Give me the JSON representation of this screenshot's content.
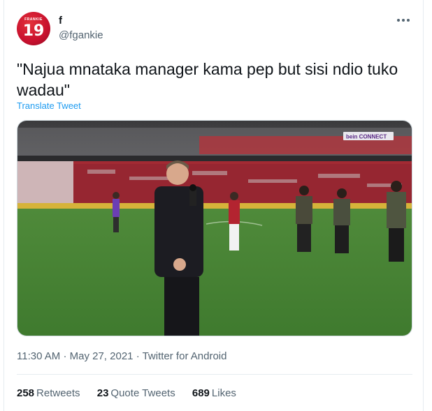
{
  "user": {
    "display_name": "f",
    "handle": "@fgankie",
    "avatar_top_text": "FRANKIE",
    "avatar_number": "19"
  },
  "menu_icon": "more-horizontal-icon",
  "tweet": {
    "text": "\"Najua mnataka manager kama pep but sisi ndio tuko wadau\"",
    "translate_label": "Translate Tweet"
  },
  "media": {
    "broadcaster_logo_text": "bein CONNECT",
    "description_icon": "video-still"
  },
  "meta": {
    "time": "11:30 AM",
    "separator": "·",
    "date": "May 27, 2021",
    "source": "Twitter for Android"
  },
  "stats": {
    "retweets_count": "258",
    "retweets_label": "Retweets",
    "quote_count": "23",
    "quote_label": "Quote Tweets",
    "likes_count": "689",
    "likes_label": "Likes"
  },
  "colors": {
    "link": "#1d9bf0",
    "secondary_text": "#536471",
    "avatar_red": "#c8102e"
  }
}
